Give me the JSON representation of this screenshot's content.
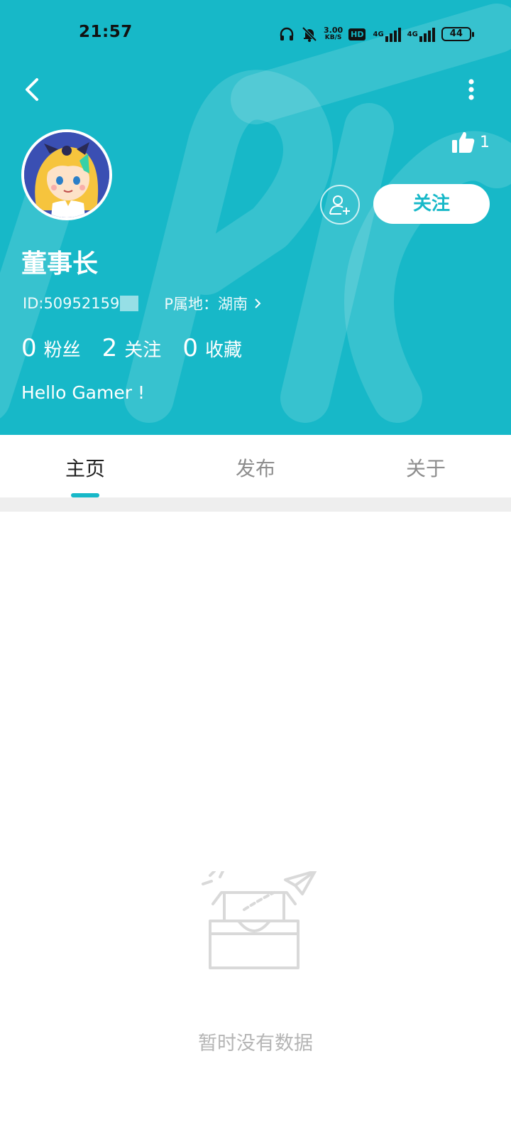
{
  "status_bar": {
    "time": "21:57",
    "net_speed_value": "3.00",
    "net_speed_unit": "KB/S",
    "hd_label": "HD",
    "signal_1_label": "4G",
    "signal_2_label": "4G",
    "battery": "44",
    "icons": [
      "headphones-icon",
      "bell-muted-icon",
      "signal-icon",
      "battery-icon"
    ]
  },
  "header": {
    "back_icon": "chevron-left-icon",
    "more_icon": "more-vertical-icon",
    "like_icon": "thumbs-up-icon",
    "like_count": "1",
    "follow_label": "关注",
    "add_friend_icon": "add-user-icon"
  },
  "profile": {
    "username": "董事长",
    "id_text": "ID:50952159",
    "ip_location": "P属地：湖南",
    "stats": [
      {
        "count": "0",
        "label": "粉丝"
      },
      {
        "count": "2",
        "label": "关注"
      },
      {
        "count": "0",
        "label": "收藏"
      }
    ],
    "bio": "Hello Gamer !"
  },
  "tabs": [
    {
      "label": "主页",
      "active": true
    },
    {
      "label": "发布",
      "active": false
    },
    {
      "label": "关于",
      "active": false
    }
  ],
  "empty_state": {
    "icon": "empty-inbox-icon",
    "text": "暂时没有数据"
  },
  "colors": {
    "accent": "#17b8c8",
    "tab_active": "#222222",
    "tab_inactive": "#8e8e8e",
    "empty_text": "#b5b5b5"
  }
}
